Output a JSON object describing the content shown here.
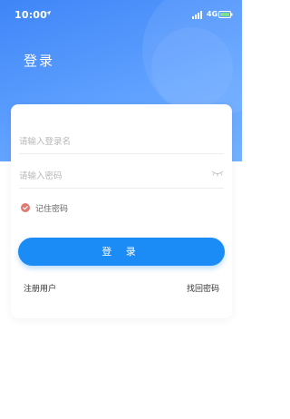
{
  "status_bar": {
    "time": "10:00",
    "network": "4G"
  },
  "header": {
    "title": "登录"
  },
  "form": {
    "username_placeholder": "请输入登录名",
    "password_placeholder": "请输入密码",
    "remember_label": "记住密码",
    "remember_checked": true,
    "login_label": "登 录"
  },
  "links": {
    "register": "注册用户",
    "forgot": "找回密码"
  },
  "colors": {
    "primary": "#1b8bf6",
    "hero": "#4b8ff8",
    "check": "#e07a70"
  },
  "icons": [
    "location-arrow-icon",
    "signal-icon",
    "battery-icon",
    "eye-closed-icon",
    "check-icon"
  ]
}
